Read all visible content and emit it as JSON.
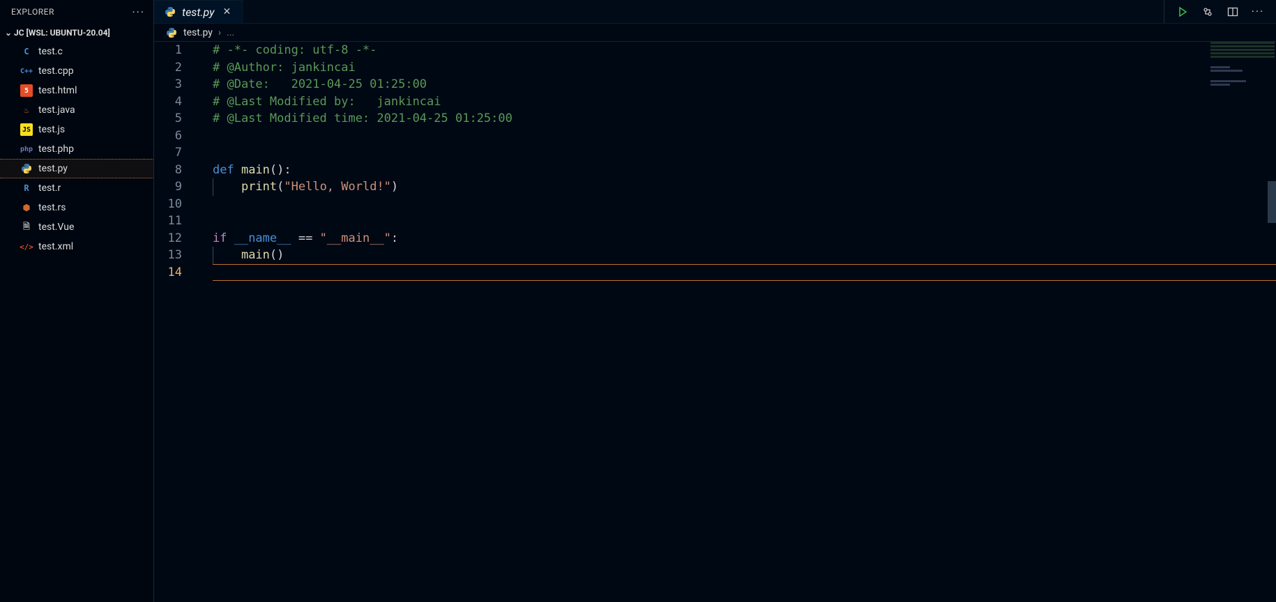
{
  "explorer": {
    "title": "EXPLORER",
    "workspace": "JC [WSL: UBUNTU-20.04]",
    "files": [
      {
        "name": "test.c",
        "iconClass": "fi-c",
        "iconText": "C",
        "iconName": "c-file-icon"
      },
      {
        "name": "test.cpp",
        "iconClass": "fi-cpp",
        "iconText": "C++",
        "iconName": "cpp-file-icon"
      },
      {
        "name": "test.html",
        "iconClass": "fi-html",
        "iconText": "5",
        "iconName": "html-file-icon"
      },
      {
        "name": "test.java",
        "iconClass": "fi-java",
        "iconText": "♨",
        "iconName": "java-file-icon"
      },
      {
        "name": "test.js",
        "iconClass": "fi-js",
        "iconText": "JS",
        "iconName": "js-file-icon"
      },
      {
        "name": "test.php",
        "iconClass": "fi-php",
        "iconText": "php",
        "iconName": "php-file-icon"
      },
      {
        "name": "test.py",
        "iconClass": "fi-py",
        "iconText": "",
        "iconName": "python-file-icon",
        "active": true,
        "svg": "python"
      },
      {
        "name": "test.r",
        "iconClass": "fi-r",
        "iconText": "R",
        "iconName": "r-file-icon"
      },
      {
        "name": "test.rs",
        "iconClass": "fi-rs",
        "iconText": "⬢",
        "iconName": "rust-file-icon"
      },
      {
        "name": "test.Vue",
        "iconClass": "fi-vue",
        "iconText": "🗎",
        "iconName": "vue-file-icon"
      },
      {
        "name": "test.xml",
        "iconClass": "fi-xml",
        "iconText": "</>",
        "iconName": "xml-file-icon"
      }
    ]
  },
  "tab": {
    "label": "test.py",
    "iconName": "python-file-icon"
  },
  "breadcrumb": {
    "file": "test.py",
    "rest": "..."
  },
  "editor": {
    "activeLine": 14,
    "lines": [
      {
        "n": 1,
        "tokens": [
          {
            "t": "# -*- coding: utf-8 -*-",
            "c": "tok-comment"
          }
        ]
      },
      {
        "n": 2,
        "tokens": [
          {
            "t": "# @Author: jankincai",
            "c": "tok-comment"
          }
        ]
      },
      {
        "n": 3,
        "tokens": [
          {
            "t": "# @Date:   2021-04-25 01:25:00",
            "c": "tok-comment"
          }
        ]
      },
      {
        "n": 4,
        "tokens": [
          {
            "t": "# @Last Modified by:   jankincai",
            "c": "tok-comment"
          }
        ]
      },
      {
        "n": 5,
        "tokens": [
          {
            "t": "# @Last Modified time: 2021-04-25 01:25:00",
            "c": "tok-comment"
          }
        ]
      },
      {
        "n": 6,
        "tokens": []
      },
      {
        "n": 7,
        "tokens": []
      },
      {
        "n": 8,
        "tokens": [
          {
            "t": "def ",
            "c": "tok-keyword2"
          },
          {
            "t": "main",
            "c": "tok-func"
          },
          {
            "t": "():",
            "c": "tok-default"
          }
        ]
      },
      {
        "n": 9,
        "indent": true,
        "tokens": [
          {
            "t": "    ",
            "c": ""
          },
          {
            "t": "print",
            "c": "tok-func"
          },
          {
            "t": "(",
            "c": "tok-default"
          },
          {
            "t": "\"Hello, World!\"",
            "c": "tok-str"
          },
          {
            "t": ")",
            "c": "tok-default"
          }
        ]
      },
      {
        "n": 10,
        "tokens": []
      },
      {
        "n": 11,
        "tokens": []
      },
      {
        "n": 12,
        "tokens": [
          {
            "t": "if ",
            "c": "tok-keyword"
          },
          {
            "t": "__name__",
            "c": "tok-dunder"
          },
          {
            "t": " == ",
            "c": "tok-default"
          },
          {
            "t": "\"__main__\"",
            "c": "tok-str"
          },
          {
            "t": ":",
            "c": "tok-default"
          }
        ]
      },
      {
        "n": 13,
        "indent": true,
        "tokens": [
          {
            "t": "    ",
            "c": ""
          },
          {
            "t": "main",
            "c": "tok-func"
          },
          {
            "t": "()",
            "c": "tok-default"
          }
        ]
      },
      {
        "n": 14,
        "tokens": []
      }
    ]
  }
}
